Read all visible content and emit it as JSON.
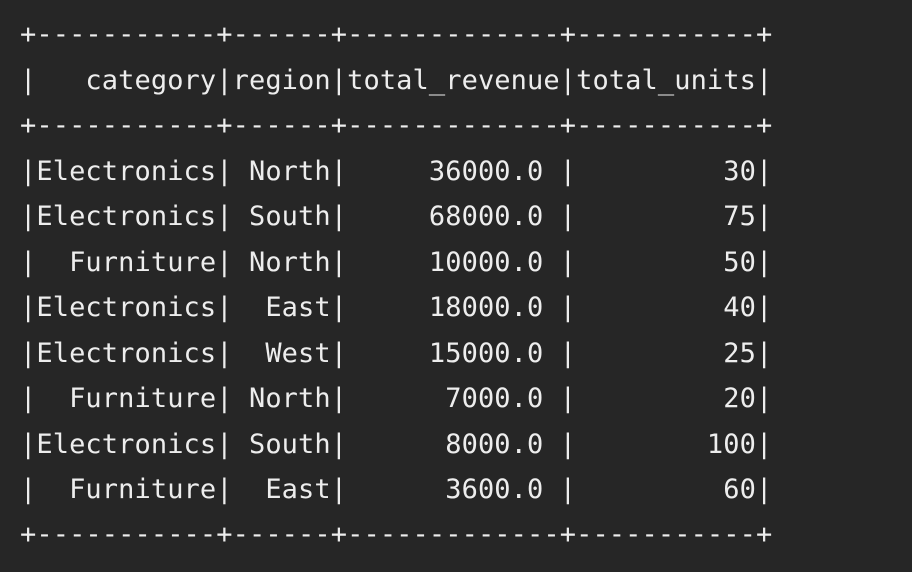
{
  "table": {
    "border": "+-----------+------+-------------+-----------+",
    "header": "|   category|region|total_revenue|total_units|",
    "rows": [
      "|Electronics| North|     36000.0 |         30|",
      "|Electronics| South|     68000.0 |         75|",
      "|  Furniture| North|     10000.0 |         50|",
      "|Electronics|  East|     18000.0 |         40|",
      "|Electronics|  West|     15000.0 |         25|",
      "|  Furniture| North|      7000.0 |         20|",
      "|Electronics| South|      8000.0 |        100|",
      "|  Furniture|  East|      3600.0 |         60|"
    ]
  },
  "colors": {
    "background": "#262626",
    "text": "#ededed"
  }
}
